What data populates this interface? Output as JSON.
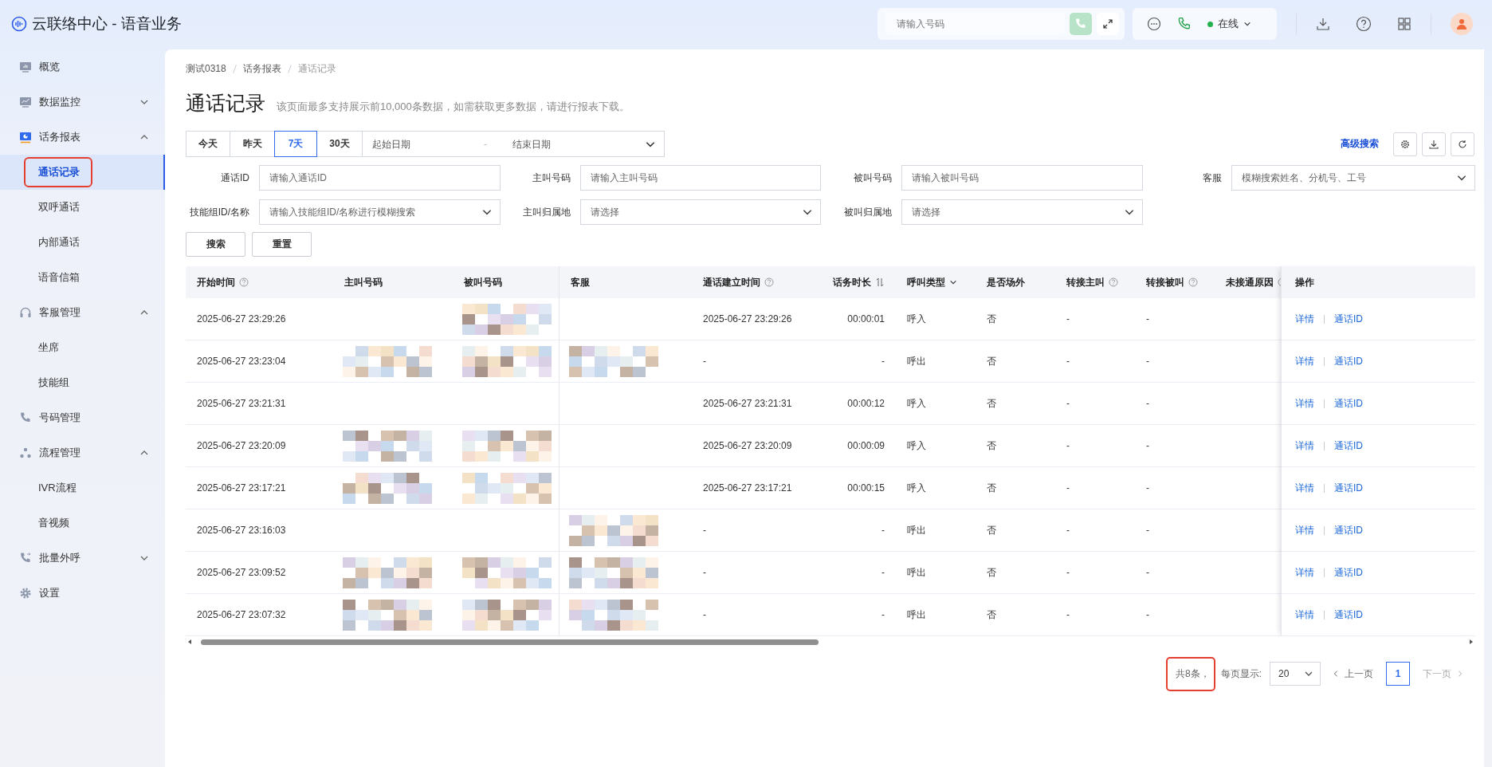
{
  "header": {
    "app_title": "云联络中心 - 语音业务",
    "dial": {
      "placeholder": "请输入号码"
    },
    "status": "在线"
  },
  "sidebar": {
    "items": [
      {
        "label": "概览"
      },
      {
        "label": "数据监控",
        "expanded": false
      },
      {
        "label": "话务报表",
        "expanded": true,
        "children": [
          {
            "label": "通话记录",
            "selected": true,
            "highlighted": true
          },
          {
            "label": "双呼通话",
            "selected": false,
            "highlighted": false
          },
          {
            "label": "内部通话",
            "selected": false,
            "highlighted": false
          },
          {
            "label": "语音信箱",
            "selected": false,
            "highlighted": false
          }
        ]
      },
      {
        "label": "客服管理",
        "expanded": true,
        "children": [
          {
            "label": "坐席",
            "selected": false,
            "highlighted": false
          },
          {
            "label": "技能组",
            "selected": false,
            "highlighted": false
          }
        ]
      },
      {
        "label": "号码管理"
      },
      {
        "label": "流程管理",
        "expanded": true,
        "children": [
          {
            "label": "IVR流程",
            "selected": false,
            "highlighted": false
          },
          {
            "label": "音视频",
            "selected": false,
            "highlighted": false
          }
        ]
      },
      {
        "label": "批量外呼",
        "expanded": false
      },
      {
        "label": "设置"
      }
    ]
  },
  "breadcrumbs": [
    "测试0318",
    "话务报表",
    "通话记录"
  ],
  "page": {
    "title": "通话记录",
    "notice": "该页面最多支持展示前10,000条数据，如需获取更多数据，请进行报表下载。"
  },
  "date_range": {
    "tabs": [
      {
        "label": "今天",
        "selected": false
      },
      {
        "label": "昨天",
        "selected": false
      },
      {
        "label": "7天",
        "selected": true
      },
      {
        "label": "30天",
        "selected": false
      }
    ],
    "start_placeholder": "起始日期",
    "separator": "-",
    "end_placeholder": "结束日期"
  },
  "advanced_search": "高级搜索",
  "filters": [
    {
      "label": "通话ID",
      "placeholder": "请输入通话ID",
      "kind": "input"
    },
    {
      "label": "主叫号码",
      "placeholder": "请输入主叫号码",
      "kind": "input"
    },
    {
      "label": "被叫号码",
      "placeholder": "请输入被叫号码",
      "kind": "input"
    },
    {
      "label": "客服",
      "placeholder": "模糊搜索姓名、分机号、工号",
      "kind": "select"
    },
    {
      "label": "技能组ID/名称",
      "placeholder": "请输入技能组ID/名称进行模糊搜索",
      "kind": "select"
    },
    {
      "label": "主叫归属地",
      "placeholder": "请选择",
      "kind": "select"
    },
    {
      "label": "被叫归属地",
      "placeholder": "请选择",
      "kind": "select"
    }
  ],
  "actions": [
    "搜索",
    "重置"
  ],
  "table": {
    "columns": [
      {
        "label": "开始时间",
        "kind": "help"
      },
      {
        "label": "主叫号码",
        "kind": "plain"
      },
      {
        "label": "被叫号码",
        "kind": "plain"
      },
      {
        "label": "客服",
        "kind": "plain"
      },
      {
        "label": "通话建立时间",
        "kind": "help"
      },
      {
        "label": "话务时长",
        "kind": "sort"
      },
      {
        "label": "呼叫类型",
        "kind": "filter"
      },
      {
        "label": "是否场外",
        "kind": "plain"
      },
      {
        "label": "转接主叫",
        "kind": "help"
      },
      {
        "label": "转接被叫",
        "kind": "help"
      },
      {
        "label": "未接通原因",
        "kind": "help"
      }
    ],
    "action_column": "操作",
    "rows": [
      {
        "cells": [
          "2025-06-27 23:29:26",
          {
            "masked": false
          },
          {
            "masked": true
          },
          {
            "masked": false
          },
          "2025-06-27 23:29:26",
          "00:00:01",
          "呼入",
          "否",
          "-",
          "-"
        ],
        "links": [
          "详情",
          "通话ID"
        ]
      },
      {
        "cells": [
          "2025-06-27 23:23:04",
          {
            "masked": true
          },
          {
            "masked": true
          },
          {
            "masked": true
          },
          "-",
          "-",
          "呼出",
          "否",
          "-",
          "-"
        ],
        "links": [
          "详情",
          "通话ID"
        ]
      },
      {
        "cells": [
          "2025-06-27 23:21:31",
          {
            "masked": false
          },
          {
            "masked": false
          },
          {
            "masked": false
          },
          "2025-06-27 23:21:31",
          "00:00:12",
          "呼入",
          "否",
          "-",
          "-"
        ],
        "links": [
          "详情",
          "通话ID"
        ]
      },
      {
        "cells": [
          "2025-06-27 23:20:09",
          {
            "masked": true
          },
          {
            "masked": true
          },
          {
            "masked": false
          },
          "2025-06-27 23:20:09",
          "00:00:09",
          "呼入",
          "否",
          "-",
          "-"
        ],
        "links": [
          "详情",
          "通话ID"
        ]
      },
      {
        "cells": [
          "2025-06-27 23:17:21",
          {
            "masked": true
          },
          {
            "masked": true
          },
          {
            "masked": false
          },
          "2025-06-27 23:17:21",
          "00:00:15",
          "呼入",
          "否",
          "-",
          "-"
        ],
        "links": [
          "详情",
          "通话ID"
        ]
      },
      {
        "cells": [
          "2025-06-27 23:16:03",
          {
            "masked": false
          },
          {
            "masked": false
          },
          {
            "masked": true
          },
          "-",
          "-",
          "呼出",
          "否",
          "-",
          "-"
        ],
        "links": [
          "详情",
          "通话ID"
        ]
      },
      {
        "cells": [
          "2025-06-27 23:09:52",
          {
            "masked": true
          },
          {
            "masked": true
          },
          {
            "masked": true
          },
          "-",
          "-",
          "呼出",
          "否",
          "-",
          "-"
        ],
        "links": [
          "详情",
          "通话ID"
        ]
      },
      {
        "cells": [
          "2025-06-27 23:07:32",
          {
            "masked": true
          },
          {
            "masked": true
          },
          {
            "masked": true
          },
          "-",
          "-",
          "呼出",
          "否",
          "-",
          "-"
        ],
        "links": [
          "详情",
          "通话ID"
        ]
      }
    ]
  },
  "pagination": {
    "total": "共8条，",
    "total_highlighted": true,
    "page_size_label": "每页显示:",
    "page_size": "20",
    "prev": {
      "label": "上一页",
      "disabled": false
    },
    "pages": [
      {
        "label": "1",
        "selected": true
      }
    ],
    "next": {
      "label": "下一页",
      "disabled": true
    }
  }
}
